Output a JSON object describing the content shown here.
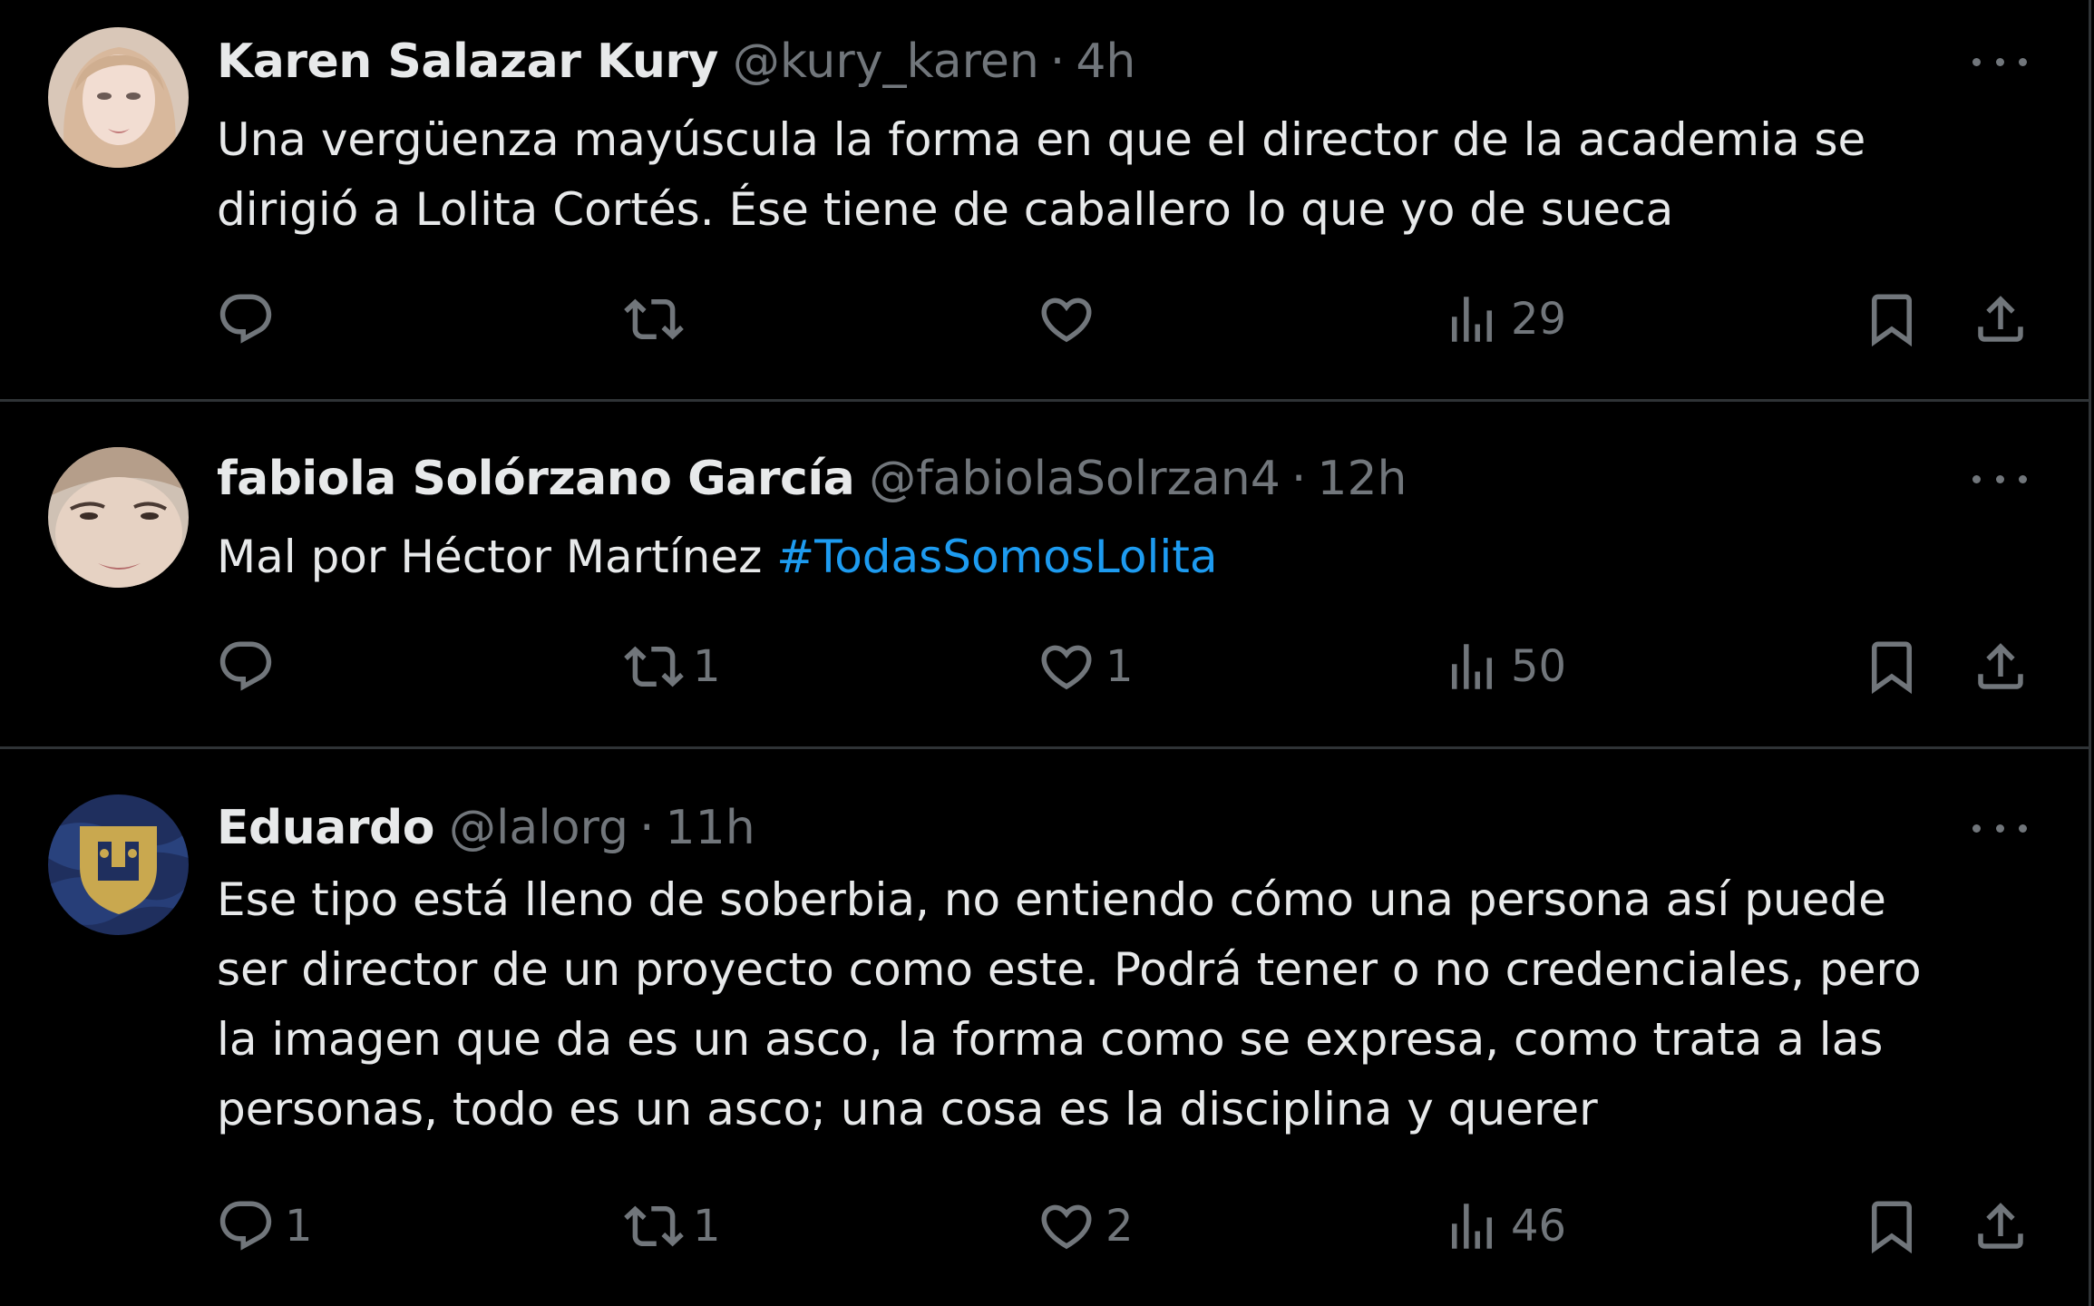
{
  "tweets": [
    {
      "name": "Karen Salazar Kury",
      "handle": "@kury_karen",
      "separator": "·",
      "time": "4h",
      "text": "Una vergüenza mayúscula la forma en que el director de la academia se\ndirigió a Lolita Cortés. Ése tiene de caballero lo que yo de sueca",
      "hashtag": "",
      "replies": "",
      "retweets": "",
      "likes": "",
      "views": "29"
    },
    {
      "name": "fabiola Solórzano García",
      "handle": "@fabiolaSolrzan4",
      "separator": "·",
      "time": "12h",
      "text": "Mal por Héctor Martínez ",
      "hashtag": "#TodasSomosLolita",
      "replies": "",
      "retweets": "1",
      "likes": "1",
      "views": "50"
    },
    {
      "name": "Eduardo",
      "handle": "@lalorg",
      "separator": "·",
      "time": "11h",
      "text": "Ese tipo está lleno de soberbia, no entiendo cómo una persona así puede\nser director de un proyecto como este. Podrá tener o no credenciales, pero\nla imagen que da es un asco, la forma como se expresa, como trata a las\npersonas, todo es un asco; una cosa es la disciplina y querer",
      "hashtag": "",
      "replies": "1",
      "retweets": "1",
      "likes": "2",
      "views": "46"
    }
  ],
  "icons": {
    "reply": "reply-icon",
    "retweet": "retweet-icon",
    "like": "heart-icon",
    "views": "views-icon",
    "bookmark": "bookmark-icon",
    "share": "share-icon",
    "more": "more-icon"
  },
  "colors": {
    "background": "#000000",
    "text": "#e7e9ea",
    "secondary": "#71767b",
    "divider": "#2f3336",
    "hashtag": "#1d9bf0"
  }
}
